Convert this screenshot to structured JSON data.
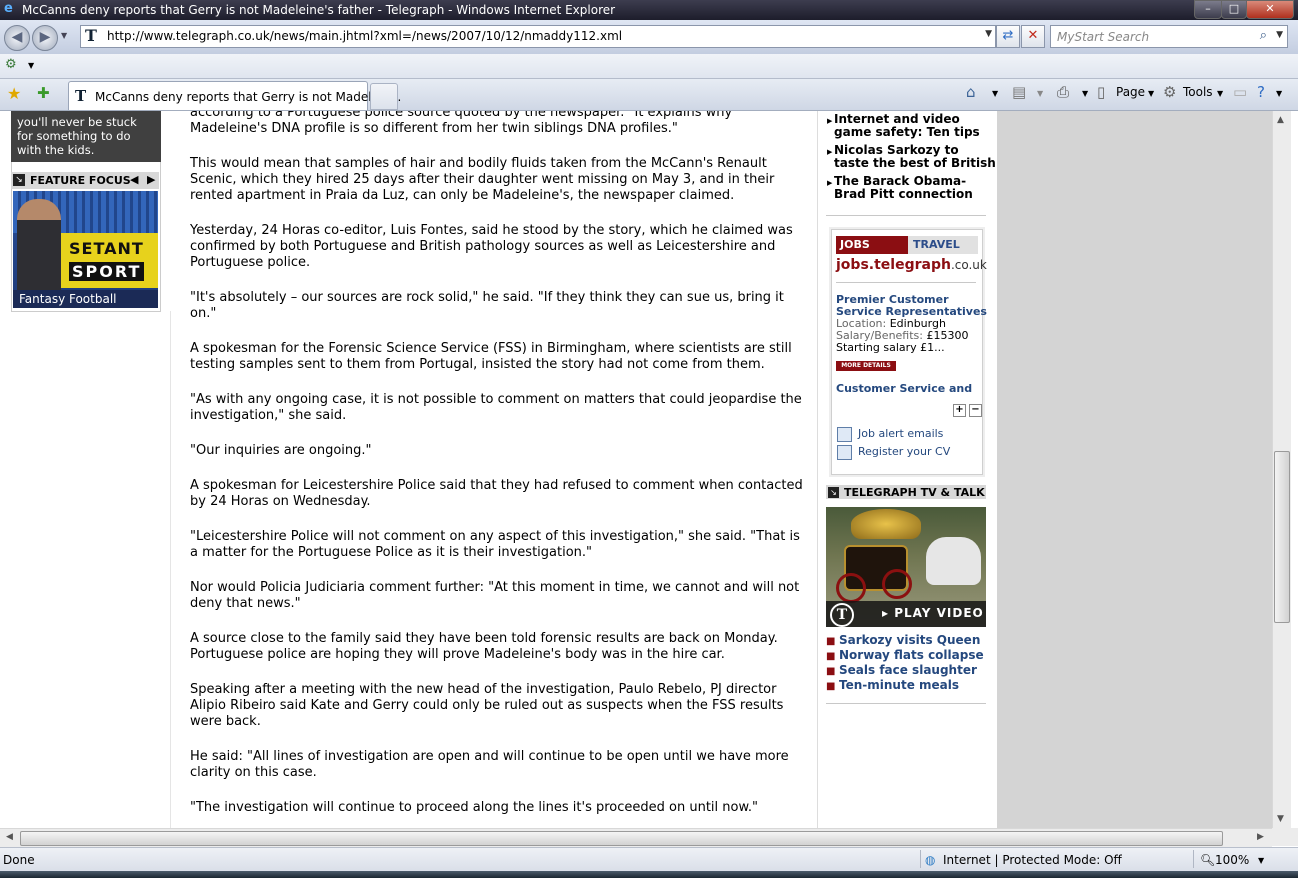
{
  "window": {
    "title": "McCanns deny reports that Gerry is not Madeleine's father - Telegraph - Windows Internet Explorer",
    "minimize_glyph": "–",
    "maximize_glyph": "□",
    "close_glyph": "✕"
  },
  "navbar": {
    "back_glyph": "◀",
    "forward_glyph": "▶",
    "url": "http://www.telegraph.co.uk/news/main.jhtml?xml=/news/2007/10/12/nmaddy112.xml",
    "refresh_glyph": "⇄",
    "stop_glyph": "✕",
    "search_placeholder": "MyStart Search",
    "search_glyph": "⌕"
  },
  "tabs": [
    {
      "label": "McCanns deny reports that Gerry is not Madelein..."
    }
  ],
  "command_bar": {
    "page_label": "Page",
    "tools_label": "Tools"
  },
  "left_column": {
    "promo_lines": [
      "you'll never be stuck",
      "for something to do",
      "with the kids."
    ],
    "feature_focus_title": "FEATURE FOCUS",
    "feature_image_brand_1": "SETANT",
    "feature_image_brand_2": "SPORT",
    "feature_caption": "Fantasy Football"
  },
  "article": {
    "paragraphs": [
      "according to a Portuguese police source quoted by the newspaper. \"It explains why Madeleine's DNA profile is so different from her twin siblings DNA profiles.\"",
      "This would mean that samples of hair and bodily fluids taken from the McCann's Renault Scenic, which they hired 25 days after their daughter went missing on May 3, and in their rented apartment in Praia da Luz, can only be Madeleine's, the newspaper claimed.",
      "Yesterday, 24 Horas co-editor, Luis Fontes, said he stood by the story, which he claimed was confirmed by both Portuguese and British pathology sources as well as Leicestershire and Portuguese police.",
      "\"It's absolutely – our sources are rock solid,\" he said. \"If they think they can sue us, bring it on.\"",
      "A spokesman for the Forensic Science Service (FSS) in Birmingham, where scientists are still testing samples sent to them from Portugal, insisted the story had not come from them.",
      "\"As with any ongoing case, it is not possible to comment on matters that could jeopardise the investigation,\" she said.",
      "\"Our inquiries are ongoing.\"",
      "A spokesman for Leicestershire Police said that they had refused to comment when contacted by 24 Horas on Wednesday.",
      "\"Leicestershire Police will not comment on any aspect of this investigation,\" she said. \"That is a matter for the Portuguese Police as it is their investigation.\"",
      "Nor would Policia Judiciaria comment further: \"At this moment in time, we cannot and will not deny that news.\"",
      "A source close to the family said they have been told forensic results are back on Monday. Portuguese police are hoping they will prove Madeleine's body was in the hire car.",
      "Speaking after a meeting with the new head of the investigation, Paulo Rebelo, PJ director Alipio Ribeiro said Kate and Gerry could only be ruled out as suspects when the FSS results were back.",
      "He said: \"All lines of investigation are open and will continue to be open until we have more clarity on this case.",
      "\"The investigation will continue to proceed along the lines it's proceeded on until now.\""
    ]
  },
  "right_column": {
    "headlines": [
      {
        "line1": "Internet and video",
        "line2": "game safety: Ten tips"
      },
      {
        "line1": "Nicolas Sarkozy to",
        "line2": "taste the best of British"
      },
      {
        "line1": "The Barack Obama-",
        "line2": "Brad Pitt connection"
      }
    ],
    "jobs": {
      "tab_jobs": "JOBS",
      "tab_travel": "TRAVEL",
      "logo_main": "jobs.telegraph",
      "logo_domain": ".co.uk",
      "job_title_line1": "Premier Customer",
      "job_title_line2": "Service Representatives",
      "location_label": "Location:",
      "location_value": "Edinburgh",
      "salary_label": "Salary/Benefits:",
      "salary_value": "£15300",
      "starting_salary": "Starting salary £1...",
      "more_details": "MORE DETAILS",
      "job2_title": "Customer Service and",
      "plus_glyph": "+",
      "minus_glyph": "−",
      "link_alerts": "Job alert emails",
      "link_cv": "Register your CV"
    },
    "tv": {
      "title": "TELEGRAPH TV & TALK",
      "play_label": "▸ PLAY VIDEO",
      "links": [
        "Sarkozy visits Queen",
        "Norway flats collapse",
        "Seals face slaughter",
        "Ten-minute meals"
      ]
    }
  },
  "statusbar": {
    "status": "Done",
    "zone": "Internet | Protected Mode: Off",
    "zoom": "100%"
  }
}
